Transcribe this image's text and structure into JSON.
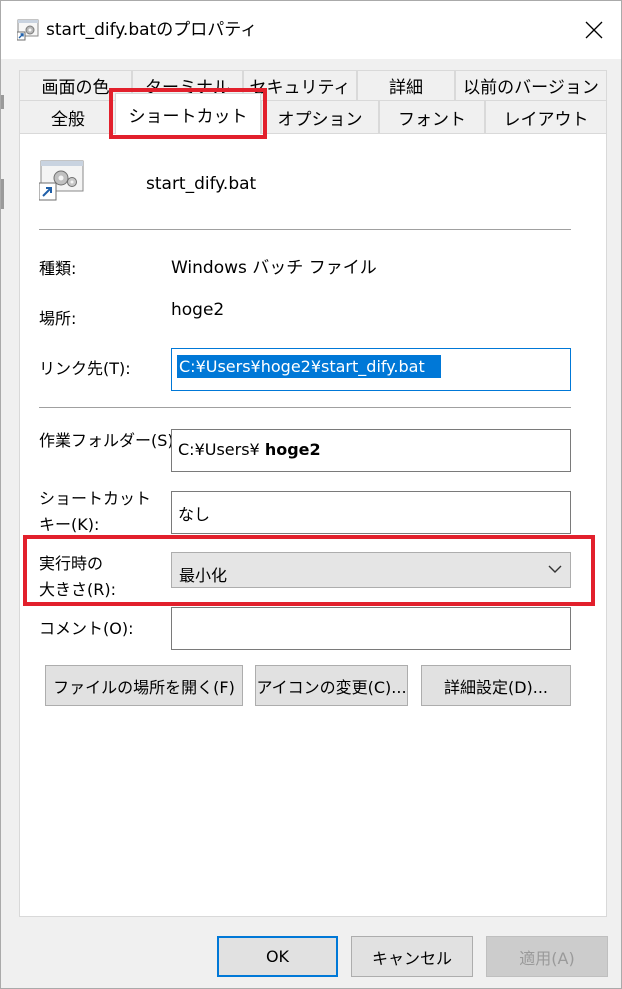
{
  "window": {
    "title": "start_dify.batのプロパティ"
  },
  "tabs": {
    "row1": [
      "画面の色",
      "ターミナル",
      "セキュリティ",
      "詳細",
      "以前のバージョン"
    ],
    "row2": [
      "全般",
      "ショートカット",
      "オプション",
      "フォント",
      "レイアウト"
    ],
    "active": "ショートカット"
  },
  "shortcut": {
    "file_name": "start_dify.bat",
    "type_label": "種類:",
    "type_value": "Windows バッチ ファイル",
    "location_label": "場所:",
    "location_value": "hoge2",
    "target_label": "リンク先(T):",
    "target_value": "C:¥Users¥hoge2¥start_dify.bat",
    "workdir_label": "作業フォルダー(S):",
    "workdir_prefix": "C:¥Users¥ ",
    "workdir_bold": "hoge2",
    "hotkey_label_1": "ショートカット",
    "hotkey_label_2": "キー(K):",
    "hotkey_value": "なし",
    "run_label_1": "実行時の",
    "run_label_2": "大きさ(R):",
    "run_value": "最小化",
    "comment_label": "コメント(O):",
    "comment_value": ""
  },
  "buttons": {
    "open_location": "ファイルの場所を開く(F)",
    "change_icon": "アイコンの変更(C)...",
    "advanced": "詳細設定(D)...",
    "ok": "OK",
    "cancel": "キャンセル",
    "apply": "適用(A)"
  },
  "colors": {
    "highlight_box": "#e2202c",
    "selection": "#0078d7"
  }
}
